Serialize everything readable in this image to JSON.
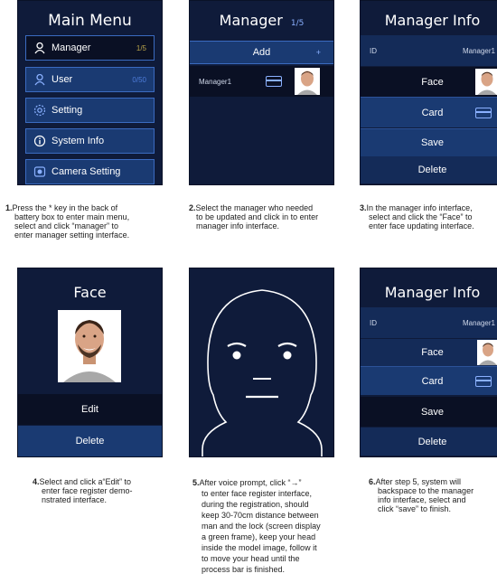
{
  "screens": {
    "s1": {
      "title": "Main Menu",
      "items": [
        {
          "label": "Manager",
          "count": "1/5"
        },
        {
          "label": "User",
          "count": "0/50"
        },
        {
          "label": "Setting"
        },
        {
          "label": "System Info"
        },
        {
          "label": "Camera Setting"
        }
      ]
    },
    "s2": {
      "title": "Manager",
      "page": "1/5",
      "add": "Add",
      "add_mark": "+",
      "row_label": "Manager1"
    },
    "s3": {
      "title": "Manager Info",
      "id_label": "ID",
      "id_value": "Manager1",
      "face": "Face",
      "card": "Card",
      "save": "Save",
      "delete": "Delete"
    },
    "s4": {
      "title": "Face",
      "edit": "Edit",
      "delete": "Delete"
    },
    "s6": {
      "title": "Manager Info",
      "id_label": "ID",
      "id_value": "Manager1",
      "face": "Face",
      "card": "Card",
      "save": "Save",
      "delete": "Delete"
    }
  },
  "captions": [
    {
      "num": "1.",
      "lines": [
        "Press the * key in the back of",
        "battery box to enter main menu,",
        "select and click  “manager” to",
        "enter manager setting interface."
      ]
    },
    {
      "num": "2.",
      "lines": [
        "Select the manager who needed",
        "to be updated and click in to enter",
        "manager info interface."
      ]
    },
    {
      "num": "3.",
      "lines": [
        "In the manager info interface,",
        "select and click the “Face” to",
        "enter face updating interface."
      ]
    },
    {
      "num": "4.",
      "lines": [
        "Select and click a“Edit” to",
        "enter face register demo-",
        "nstrated interface."
      ]
    },
    {
      "num": "5.",
      "lines": [
        "After voice prompt, click “→”",
        "to enter face register interface,",
        "during the registration, should",
        "keep 30-70cm distance between",
        "man and the lock (screen display",
        "a green frame), keep your head",
        "inside the model image, follow it",
        "to move your head until the",
        "process bar is finished."
      ]
    },
    {
      "num": "6.",
      "lines": [
        "After step 5, system will",
        "backspace to the manager",
        "info interface, select and",
        "click “save” to finish."
      ]
    }
  ]
}
